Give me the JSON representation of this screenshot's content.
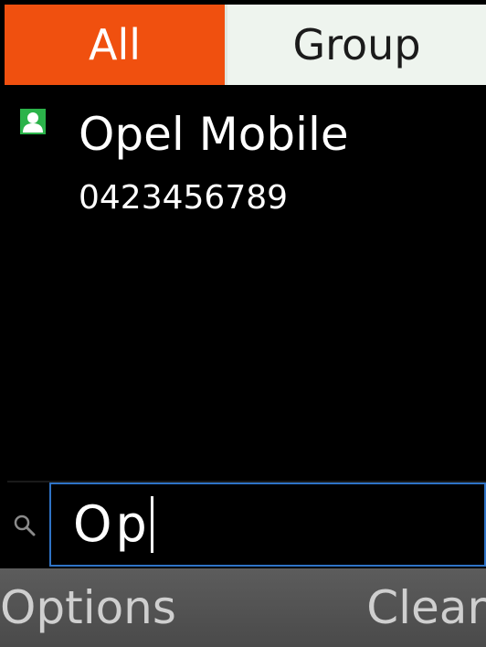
{
  "tabs": [
    {
      "label": "All",
      "active": true
    },
    {
      "label": "Group",
      "active": false
    }
  ],
  "contacts": [
    {
      "name": "Opel Mobile",
      "number": "0423456789",
      "icon": "contact-icon"
    }
  ],
  "search": {
    "value": "Op",
    "icon": "search-icon"
  },
  "softkeys": {
    "left": "Options",
    "right": "Clear"
  },
  "colors": {
    "active_tab": "#f0500f",
    "inactive_tab": "#eef4ee",
    "contact_icon": "#2bb34a",
    "search_border": "#2f73c6",
    "softkey_bar": "#545454"
  }
}
